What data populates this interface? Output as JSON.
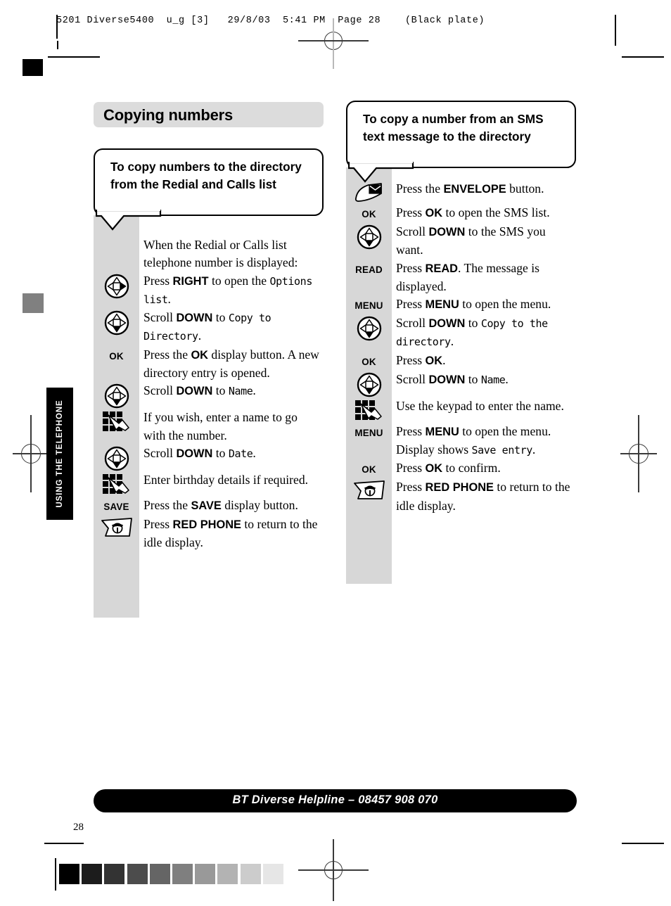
{
  "prepress": {
    "header_line": "5201 Diverse5400  u_g [3]   29/8/03  5:41 PM  Page 28    (Black plate)",
    "grayscale_steps": [
      "#000000",
      "#1c1c1c",
      "#333333",
      "#4c4c4c",
      "#656565",
      "#7f7f7f",
      "#999999",
      "#b3b3b3",
      "#cccccc",
      "#e6e6e6"
    ],
    "gray_swatch_color": "#808080"
  },
  "side_tab": {
    "label": "USING THE TELEPHONE"
  },
  "page": {
    "title": "Copying numbers",
    "number": "28"
  },
  "footer": {
    "helpline": "BT Diverse Helpline – 08457 908 070"
  },
  "left_column": {
    "bubble_title": "To copy numbers to the directory from the Redial and Calls list",
    "steps": [
      {
        "icon": "none",
        "icon_label": "",
        "text_html": "When the Redial or Calls list telephone number is displayed:"
      },
      {
        "icon": "dpad-right",
        "icon_label": "",
        "text_html": "Press <b>RIGHT</b> to open the <span class=\"lcd\">Options list</span>."
      },
      {
        "icon": "dpad-down",
        "icon_label": "",
        "text_html": "Scroll <b>DOWN</b> to <span class=\"lcd\">Copy to Directory</span>."
      },
      {
        "icon": "softkey",
        "icon_label": "OK",
        "text_html": "Press the <b>OK</b> display button. A new directory entry is opened."
      },
      {
        "icon": "dpad-down",
        "icon_label": "",
        "text_html": "Scroll <b>DOWN</b> to <span class=\"lcd\">Name</span>."
      },
      {
        "icon": "keypad",
        "icon_label": "",
        "text_html": "If you wish, enter a name to go with the number."
      },
      {
        "icon": "dpad-down",
        "icon_label": "",
        "text_html": "Scroll <b>DOWN</b> to <span class=\"lcd\">Date</span>."
      },
      {
        "icon": "keypad",
        "icon_label": "",
        "text_html": "Enter birthday details if required."
      },
      {
        "icon": "softkey",
        "icon_label": "SAVE",
        "text_html": "Press the <b>SAVE</b> display button."
      },
      {
        "icon": "redphone",
        "icon_label": "",
        "text_html": "Press <b>RED PHONE</b> to return to the idle display."
      }
    ]
  },
  "right_column": {
    "bubble_title": "To copy a number from an SMS text message to the directory",
    "steps": [
      {
        "icon": "envelope",
        "icon_label": "",
        "text_html": "Press the <b>ENVELOPE</b> button."
      },
      {
        "icon": "softkey",
        "icon_label": "OK",
        "text_html": "Press <b>OK</b> to open the SMS list."
      },
      {
        "icon": "dpad-down",
        "icon_label": "",
        "text_html": "Scroll <b>DOWN</b> to the SMS you want."
      },
      {
        "icon": "softkey",
        "icon_label": "READ",
        "text_html": "Press <b>READ</b>. The message is displayed."
      },
      {
        "icon": "softkey",
        "icon_label": "MENU",
        "text_html": "Press <b>MENU</b> to open the menu."
      },
      {
        "icon": "dpad-down",
        "icon_label": "",
        "text_html": "Scroll <b>DOWN</b> to <span class=\"lcd\">Copy to the directory</span>."
      },
      {
        "icon": "softkey",
        "icon_label": "OK",
        "text_html": "Press <b>OK</b>."
      },
      {
        "icon": "dpad-down",
        "icon_label": "",
        "text_html": "Scroll <b>DOWN</b> to <span class=\"lcd\">Name</span>."
      },
      {
        "icon": "keypad",
        "icon_label": "",
        "text_html": "Use the keypad to enter the name."
      },
      {
        "icon": "softkey",
        "icon_label": "MENU",
        "text_html": "Press <b>MENU</b> to open the menu. Display shows <span class=\"lcd\">Save entry</span>."
      },
      {
        "icon": "softkey",
        "icon_label": "OK",
        "text_html": "Press <b>OK</b> to confirm."
      },
      {
        "icon": "redphone",
        "icon_label": "",
        "text_html": "Press <b>RED PHONE</b> to return to the idle display."
      }
    ]
  }
}
